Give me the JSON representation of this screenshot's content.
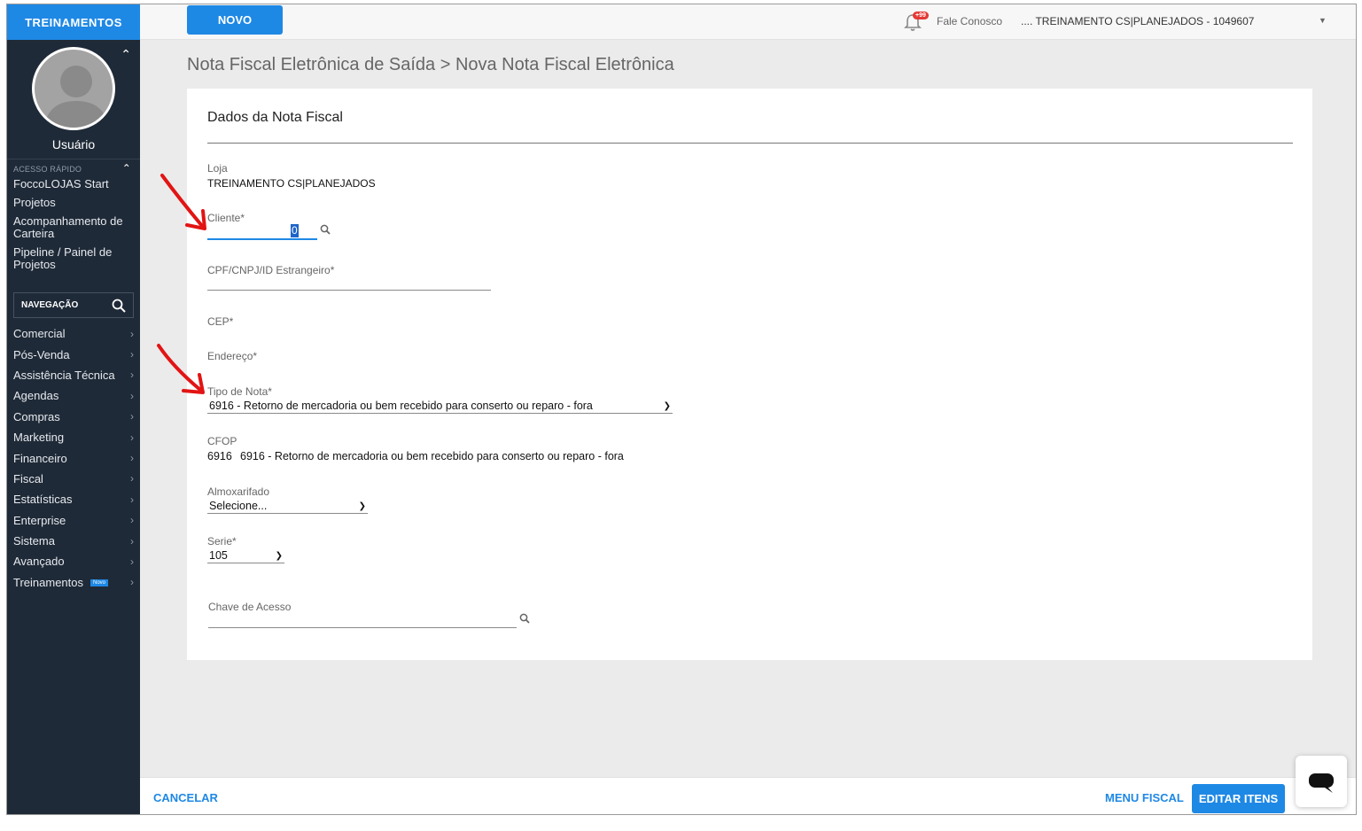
{
  "sidebar": {
    "brand": "TREINAMENTOS",
    "user_name": "Usuário",
    "quick_access_label": "ACESSO RÁPIDO",
    "quick_items": [
      "FoccoLOJAS Start",
      "Projetos",
      "Acompanhamento de Carteira",
      "Pipeline / Painel de Projetos"
    ],
    "nav_label": "NAVEGAÇÃO",
    "nav_items": [
      "Comercial",
      "Pós-Venda",
      "Assistência Técnica",
      "Agendas",
      "Compras",
      "Marketing",
      "Financeiro",
      "Fiscal",
      "Estatísticas",
      "Enterprise",
      "Sistema",
      "Avançado",
      "Treinamentos"
    ],
    "nav_badge": "Novo"
  },
  "topbar": {
    "new_button": "NOVO",
    "notifications_badge": "+99",
    "contact": "Fale Conosco",
    "store_selector": ".... TREINAMENTO CS|PLANEJADOS - 1049607"
  },
  "breadcrumb": "Nota Fiscal Eletrônica de Saída > Nova Nota Fiscal Eletrônica",
  "form": {
    "title": "Dados da Nota Fiscal",
    "loja_label": "Loja",
    "loja_value": "TREINAMENTO CS|PLANEJADOS",
    "cliente_label": "Cliente*",
    "cliente_value": "0",
    "cpf_label": "CPF/CNPJ/ID Estrangeiro*",
    "cep_label": "CEP*",
    "endereco_label": "Endereço*",
    "tipo_nota_label": "Tipo de Nota*",
    "tipo_nota_value": "6916 - Retorno de mercadoria ou bem recebido para conserto ou reparo - fora",
    "cfop_label": "CFOP",
    "cfop_code": "6916",
    "cfop_desc": "6916 - Retorno de mercadoria ou bem recebido para conserto ou reparo - fora",
    "almoxarifado_label": "Almoxarifado",
    "almoxarifado_value": "Selecione...",
    "serie_label": "Serie*",
    "serie_value": "105",
    "chave_label": "Chave de Acesso"
  },
  "bottombar": {
    "cancel": "CANCELAR",
    "menu_fiscal": "MENU FISCAL",
    "edit_items": "EDITAR ITENS"
  },
  "colors": {
    "accent": "#1e88e5",
    "sidebar_bg": "#1f2a38",
    "annotation_arrow": "#e21414"
  }
}
